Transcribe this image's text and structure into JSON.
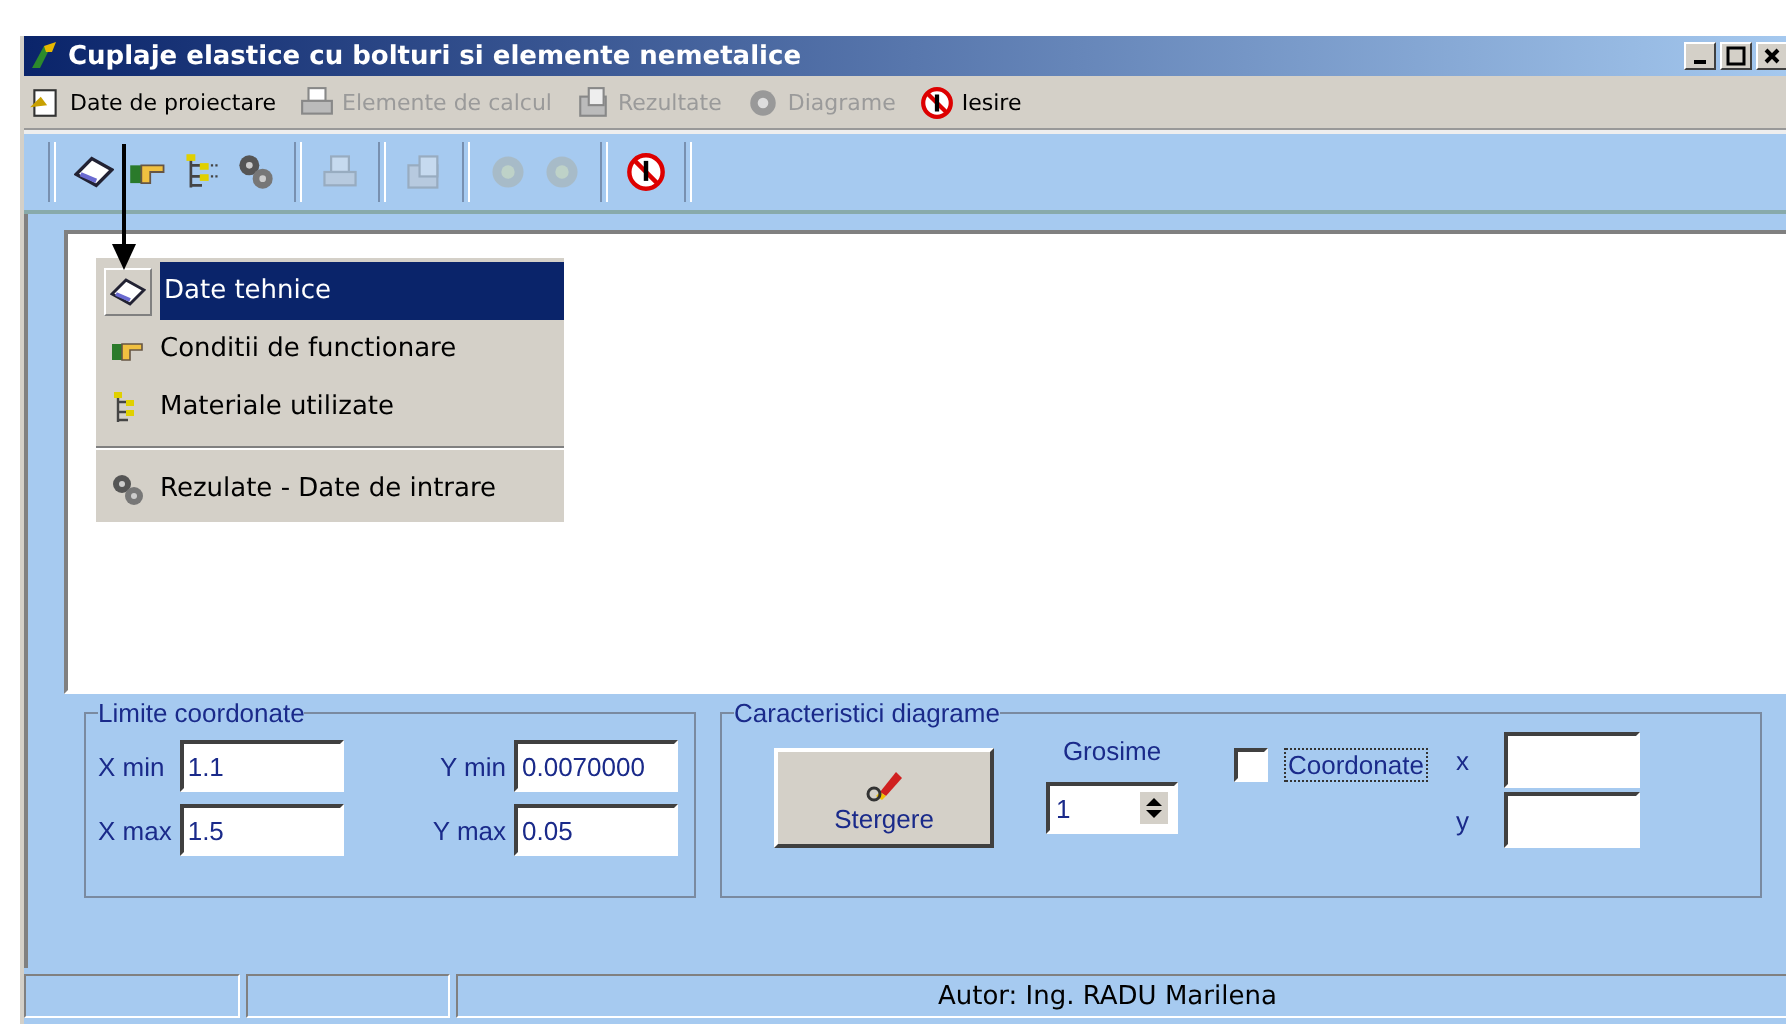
{
  "window": {
    "title": "Cuplaje elastice cu bolturi si elemente nemetalice"
  },
  "menu": [
    {
      "label": "Date de proiectare",
      "kind": "open",
      "disabled": false
    },
    {
      "label": "Elemente de calcul",
      "kind": "printer",
      "disabled": true
    },
    {
      "label": "Rezultate",
      "kind": "documents",
      "disabled": true
    },
    {
      "label": "Diagrame",
      "kind": "gear",
      "disabled": true
    },
    {
      "label": "Iesire",
      "kind": "stop",
      "disabled": false
    }
  ],
  "toolbar": [
    [
      {
        "kind": "book",
        "disabled": false
      },
      {
        "kind": "hand",
        "disabled": false
      },
      {
        "kind": "tree",
        "disabled": false
      },
      {
        "kind": "gears",
        "disabled": false
      }
    ],
    [
      {
        "kind": "printer",
        "disabled": true
      }
    ],
    [
      {
        "kind": "documents",
        "disabled": true
      }
    ],
    [
      {
        "kind": "gear",
        "disabled": true
      },
      {
        "kind": "gear",
        "disabled": true
      }
    ],
    [
      {
        "kind": "stop",
        "disabled": false
      }
    ]
  ],
  "dropdown": [
    {
      "kind": "book",
      "label": "Date tehnice",
      "selected": true
    },
    {
      "kind": "hand",
      "label": "Conditii de functionare",
      "selected": false
    },
    {
      "kind": "tree",
      "label": "Materiale utilizate",
      "selected": false
    },
    {
      "kind": "separator"
    },
    {
      "kind": "gears",
      "label": "Rezulate - Date de intrare",
      "selected": false
    }
  ],
  "limits": {
    "title": "Limite coordonate",
    "fields": [
      {
        "label": "X min",
        "value": "1.1"
      },
      {
        "label": "Y min",
        "value": "0.0070000"
      },
      {
        "label": "X max",
        "value": "1.5"
      },
      {
        "label": "Y max",
        "value": "0.05"
      }
    ]
  },
  "diagram": {
    "title": "Caracteristici diagrame",
    "button": "Stergere",
    "thickness_label": "Grosime",
    "thickness": "1",
    "coords_checkbox": {
      "label": "Coordonate",
      "checked": false
    },
    "x_label": "x",
    "y_label": "y"
  },
  "status_bar": {
    "text": "Autor: Ing. RADU Marilena"
  }
}
